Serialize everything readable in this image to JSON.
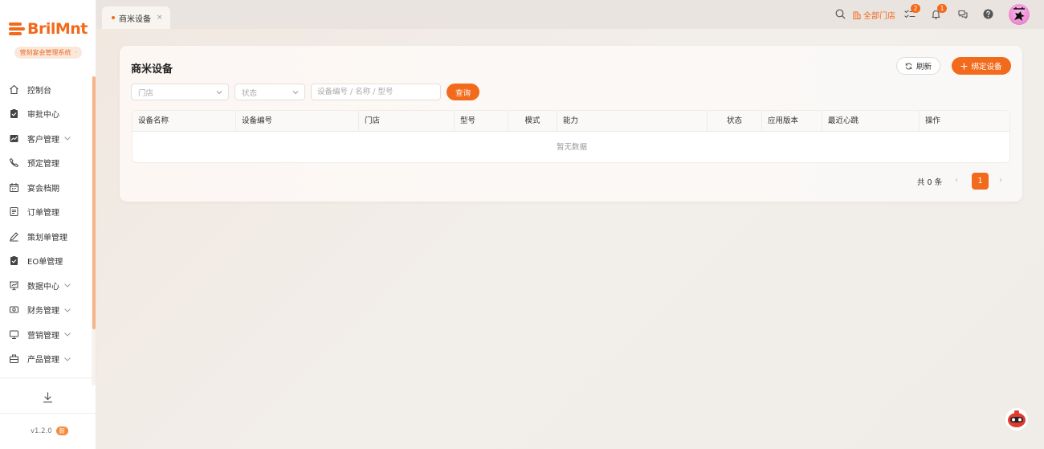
{
  "brand": {
    "name": "BrilMnt",
    "system_label": "营刻宴会管理系统",
    "system_dot": "·",
    "color": "#f26a1b"
  },
  "sidebar": {
    "items": [
      {
        "label": "控制台",
        "icon": "dashboard-icon",
        "expandable": false
      },
      {
        "label": "审批中心",
        "icon": "clipboard-check-icon",
        "expandable": false
      },
      {
        "label": "客户管理",
        "icon": "chart-board-icon",
        "expandable": true
      },
      {
        "label": "预定管理",
        "icon": "phone-icon",
        "expandable": false
      },
      {
        "label": "宴会档期",
        "icon": "calendar-icon",
        "expandable": false
      },
      {
        "label": "订单管理",
        "icon": "document-icon",
        "expandable": false
      },
      {
        "label": "策划单管理",
        "icon": "pen-icon",
        "expandable": false
      },
      {
        "label": "EO单管理",
        "icon": "clipboard-check-icon",
        "expandable": false
      },
      {
        "label": "数据中心",
        "icon": "presentation-icon",
        "expandable": true
      },
      {
        "label": "财务管理",
        "icon": "money-icon",
        "expandable": true
      },
      {
        "label": "营销管理",
        "icon": "monitor-icon",
        "expandable": true
      },
      {
        "label": "产品管理",
        "icon": "briefcase-icon",
        "expandable": true
      }
    ],
    "version": "v1.2.0",
    "version_badge": "新"
  },
  "tabs": [
    {
      "label": "商米设备",
      "active": true,
      "close": "×"
    }
  ],
  "header": {
    "store_selector": "全部门店",
    "todo_badge": "2",
    "notification_badge": "1",
    "todo_badge_color": "#f26a1b",
    "notification_badge_color": "#f26a1b"
  },
  "page": {
    "title": "商米设备",
    "refresh_label": "刷新",
    "bind_label": "绑定设备",
    "filters": {
      "store_placeholder": "门店",
      "status_placeholder": "状态",
      "search_placeholder": "设备编号 / 名称 / 型号",
      "query_label": "查询"
    },
    "table": {
      "columns": [
        "设备名称",
        "设备编号",
        "门店",
        "型号",
        "模式",
        "能力",
        "状态",
        "应用版本",
        "最近心跳",
        "操作"
      ],
      "rows": [],
      "empty_text": "暂无数据"
    },
    "pagination": {
      "total_text": "共 0 条",
      "current_page": "1",
      "prev": "‹",
      "next": "›"
    }
  }
}
